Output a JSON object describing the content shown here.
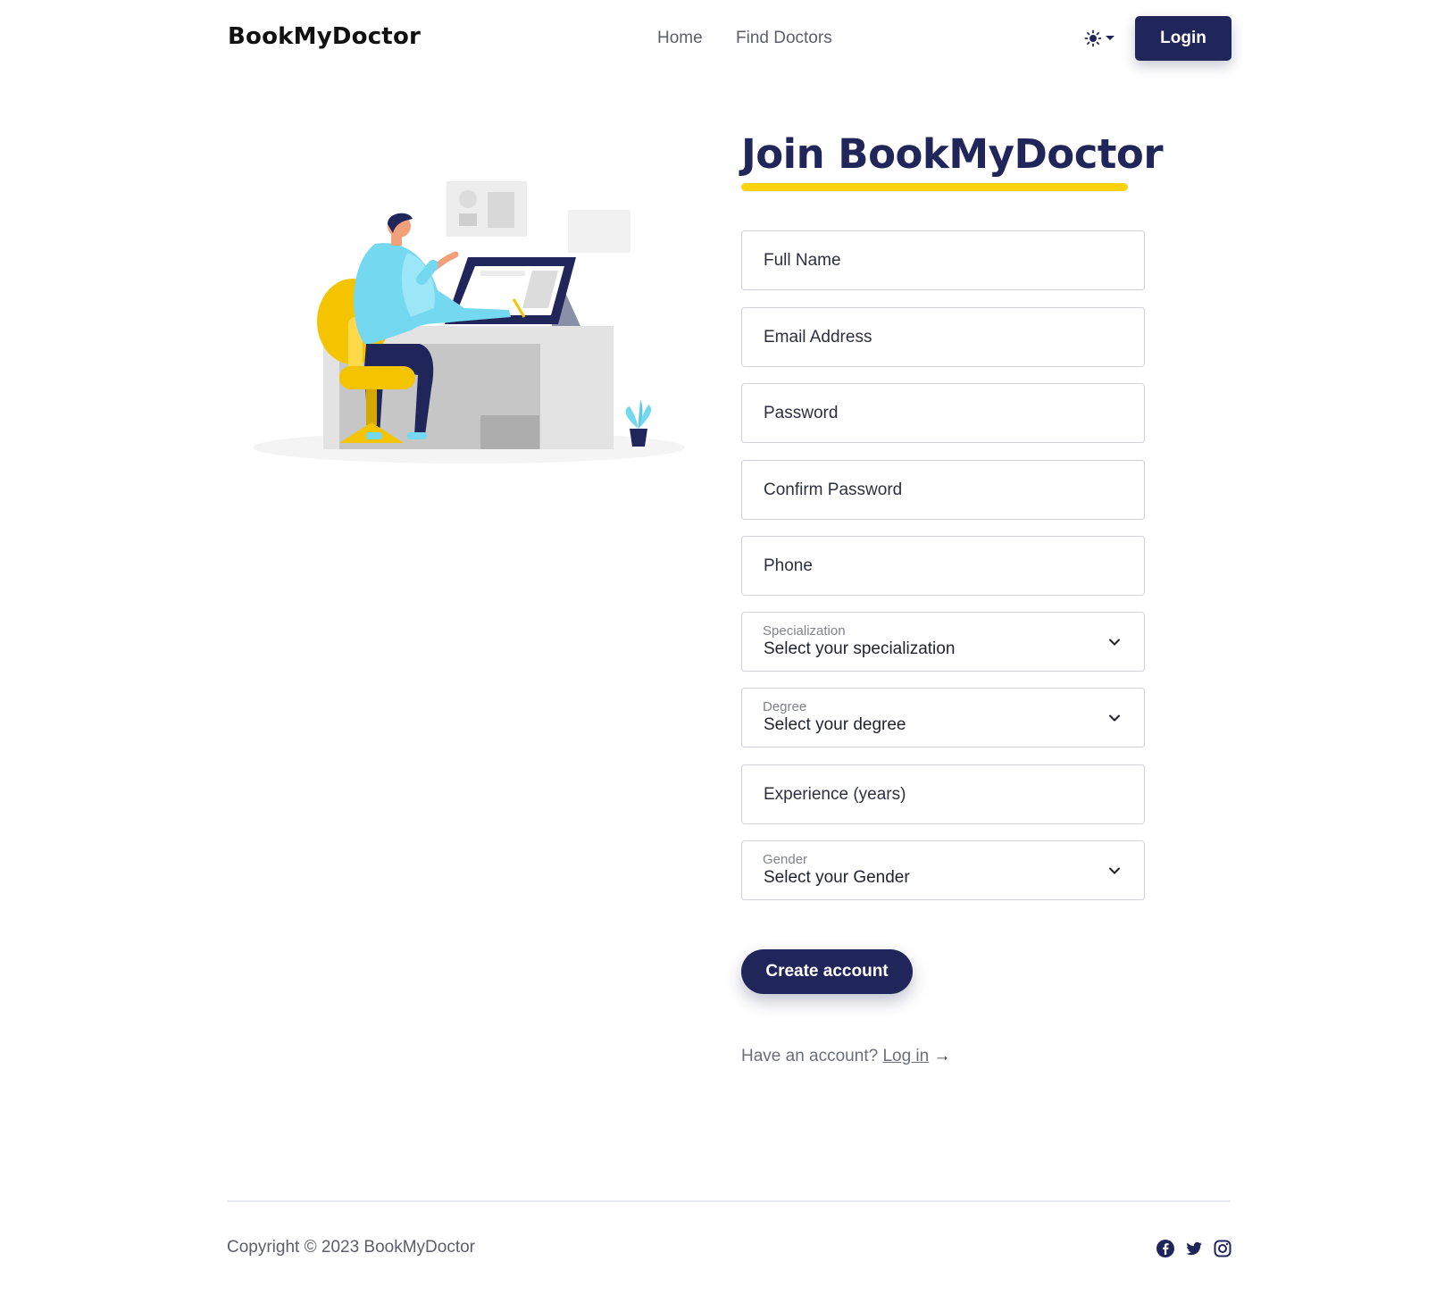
{
  "header": {
    "brand": "BookMyDoctor",
    "nav": {
      "home": "Home",
      "find_doctors": "Find Doctors"
    },
    "theme_icon": "sun-icon",
    "login_label": "Login"
  },
  "signup": {
    "title": "Join BookMyDoctor",
    "fields": {
      "full_name": "Full Name",
      "email": "Email Address",
      "password": "Password",
      "confirm_password": "Confirm Password",
      "phone": "Phone",
      "specialization_label": "Specialization",
      "specialization_value": "Select your specialization",
      "degree_label": "Degree",
      "degree_value": "Select your degree",
      "experience": "Experience (years)",
      "gender_label": "Gender",
      "gender_value": "Select your Gender"
    },
    "create_label": "Create account",
    "have_account": "Have an account?",
    "login_link": "Log in",
    "arrow": "→"
  },
  "footer": {
    "copyright": "Copyright © 2023 BookMyDoctor",
    "social_icons": [
      "facebook-icon",
      "twitter-icon",
      "instagram-icon"
    ]
  },
  "colors": {
    "primary": "#21265a",
    "accent": "#fdd20e",
    "border": "#cfd2d8"
  }
}
